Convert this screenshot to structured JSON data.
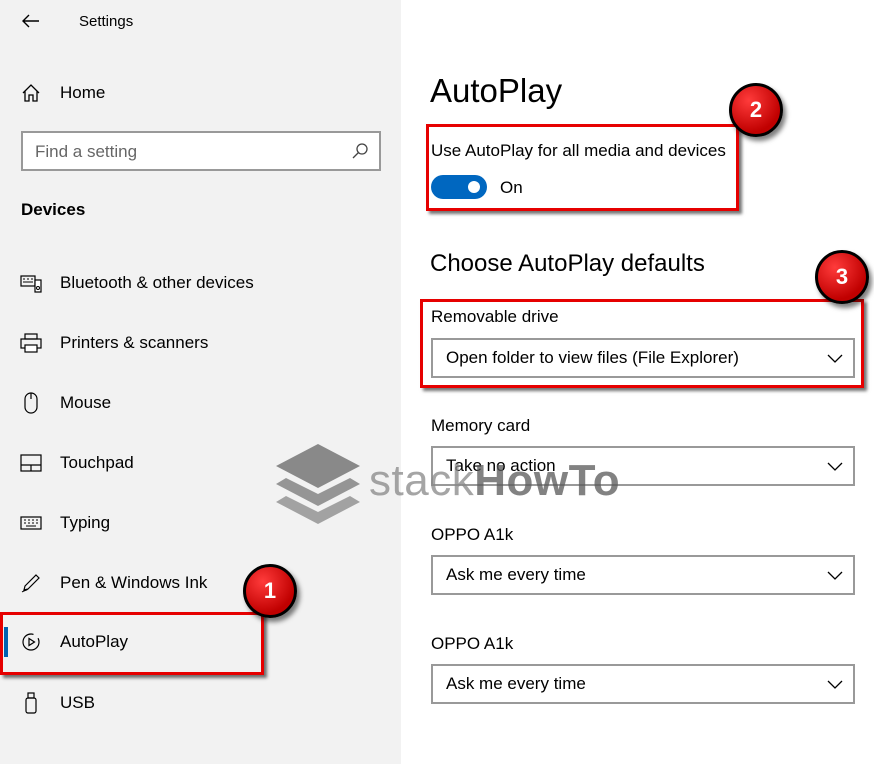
{
  "window": {
    "app_title": "Settings"
  },
  "sidebar": {
    "search_placeholder": "Find a setting",
    "home_label": "Home",
    "section_heading": "Devices",
    "items": [
      {
        "label": "Bluetooth & other devices",
        "icon": "bluetooth-devices-icon"
      },
      {
        "label": "Printers & scanners",
        "icon": "printer-icon"
      },
      {
        "label": "Mouse",
        "icon": "mouse-icon"
      },
      {
        "label": "Touchpad",
        "icon": "touchpad-icon"
      },
      {
        "label": "Typing",
        "icon": "keyboard-icon"
      },
      {
        "label": "Pen & Windows Ink",
        "icon": "pen-icon"
      },
      {
        "label": "AutoPlay",
        "icon": "autoplay-icon",
        "selected": true
      },
      {
        "label": "USB",
        "icon": "usb-icon"
      }
    ]
  },
  "main": {
    "title": "AutoPlay",
    "toggle": {
      "label": "Use AutoPlay for all media and devices",
      "state": "On",
      "on": true
    },
    "defaults_heading": "Choose AutoPlay defaults",
    "fields": [
      {
        "label": "Removable drive",
        "value": "Open folder to view files (File Explorer)"
      },
      {
        "label": "Memory card",
        "value": "Take no action"
      },
      {
        "label": "OPPO A1k",
        "value": "Ask me every time"
      },
      {
        "label": "OPPO A1k",
        "value": "Ask me every time"
      }
    ]
  },
  "annotations": {
    "step1": "1",
    "step2": "2",
    "step3": "3"
  },
  "watermark": {
    "text_light": "stack",
    "text_bold": "HowTo"
  },
  "colors": {
    "accent": "#0067c0",
    "highlight": "#e60000",
    "sidebar_bg": "#f2f2f2"
  }
}
